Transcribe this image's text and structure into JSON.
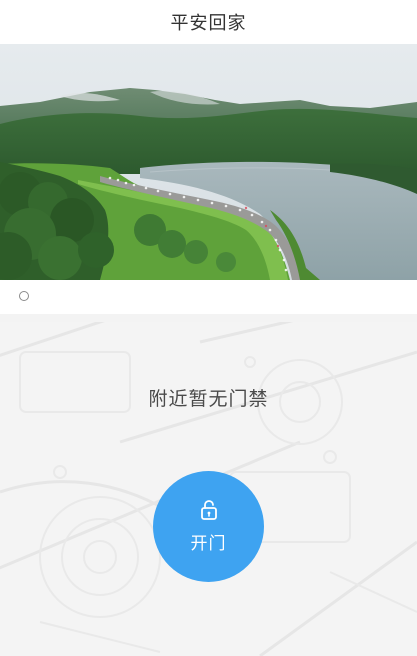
{
  "header": {
    "title": "平安回家"
  },
  "banner": {
    "image": "mountain-lake-marathon-photo",
    "indicator_count": 1
  },
  "door_panel": {
    "empty_message": "附近暂无门禁",
    "open_button": {
      "label": "开门",
      "icon": "unlock-icon",
      "color": "#3ea3f1"
    }
  },
  "colors": {
    "accent": "#3ea3f1",
    "panel_background": "#f4f4f4"
  }
}
